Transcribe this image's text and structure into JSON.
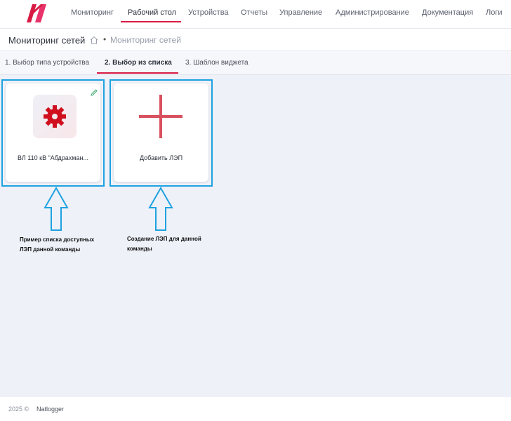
{
  "nav": {
    "items": [
      {
        "label": "Мониторинг"
      },
      {
        "label": "Рабочий стол"
      },
      {
        "label": "Устройства"
      },
      {
        "label": "Отчеты"
      },
      {
        "label": "Управление"
      },
      {
        "label": "Администрирование"
      },
      {
        "label": "Документация"
      },
      {
        "label": "Логи"
      }
    ],
    "active": "Рабочий стол",
    "brand_color": "#d81b43"
  },
  "header": {
    "title": "Мониторинг сетей",
    "breadcrumb_current": "Мониторинг сетей",
    "breadcrumb_separator": "•"
  },
  "steps": [
    {
      "label": "1. Выбор типа устройства"
    },
    {
      "label": "2. Выбор из списка"
    },
    {
      "label": "3. Шаблон виджета"
    }
  ],
  "cards": [
    {
      "label": "ВЛ 110 кВ \"Абдрахман...",
      "icon": "gear-icon",
      "editable": true
    },
    {
      "label": "Добавить ЛЭП",
      "icon": "plus-icon"
    }
  ],
  "annotations": [
    {
      "line1": "Пример списка доступных",
      "line2": "ЛЭП данной команды"
    },
    {
      "line1": "Создание ЛЭП для данной",
      "line2": "команды"
    }
  ],
  "footer": {
    "copyright": "2025 ©",
    "brand": "Natlogger"
  }
}
